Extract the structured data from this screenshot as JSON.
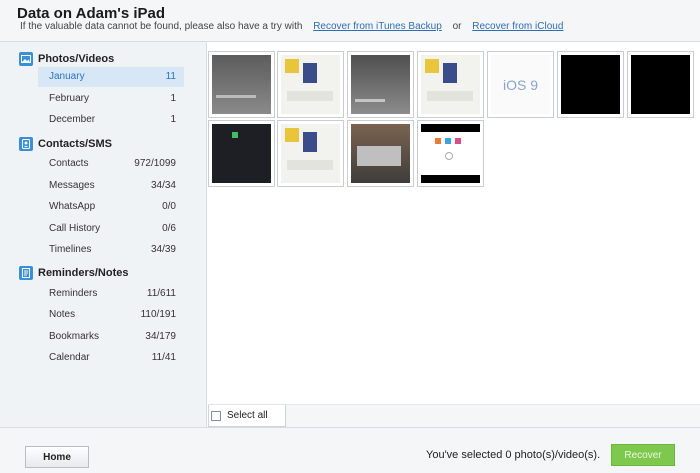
{
  "header": {
    "title": "Data on Adam's iPad",
    "subtitle_text": "If the valuable data cannot be found, please also have a try with",
    "link_itunes": "Recover from iTunes Backup",
    "or_text": "or",
    "link_icloud": "Recover from iCloud"
  },
  "sidebar": {
    "categories": [
      {
        "label": "Photos/Videos",
        "icon": "photo-icon"
      },
      {
        "label": "Contacts/SMS",
        "icon": "contacts-icon"
      },
      {
        "label": "Reminders/Notes",
        "icon": "notes-icon"
      }
    ],
    "items": [
      {
        "label": "January",
        "count": "11",
        "selected": true
      },
      {
        "label": "February",
        "count": "1"
      },
      {
        "label": "December",
        "count": "1"
      },
      {
        "label": "Contacts",
        "count": "972/1099"
      },
      {
        "label": "Messages",
        "count": "34/34"
      },
      {
        "label": "WhatsApp",
        "count": "0/0"
      },
      {
        "label": "Call History",
        "count": "0/6"
      },
      {
        "label": "Timelines",
        "count": "34/39"
      },
      {
        "label": "Reminders",
        "count": "11/611"
      },
      {
        "label": "Notes",
        "count": "110/191"
      },
      {
        "label": "Bookmarks",
        "count": "34/179"
      },
      {
        "label": "Calendar",
        "count": "11/41"
      }
    ]
  },
  "thumbnails": [
    {
      "kind": "photo-dark",
      "accent": "#7a7a7a"
    },
    {
      "kind": "screenshot-light"
    },
    {
      "kind": "photo-dark",
      "accent": "#6d6d6d"
    },
    {
      "kind": "screenshot-light"
    },
    {
      "kind": "ios9-logo",
      "text": "iOS 9"
    },
    {
      "kind": "black"
    },
    {
      "kind": "black"
    },
    {
      "kind": "dark-screen"
    },
    {
      "kind": "screenshot-light"
    },
    {
      "kind": "photo-desk"
    },
    {
      "kind": "homescreen"
    }
  ],
  "select_all": {
    "label": "Select all",
    "checked": false
  },
  "footer": {
    "home_label": "Home",
    "status_text": "You've selected 0 photo(s)/video(s).",
    "recover_label": "Recover"
  },
  "colors": {
    "accent": "#2f6eb5",
    "selected_bg": "#d7e7f6",
    "recover_green": "#7ec94d"
  }
}
